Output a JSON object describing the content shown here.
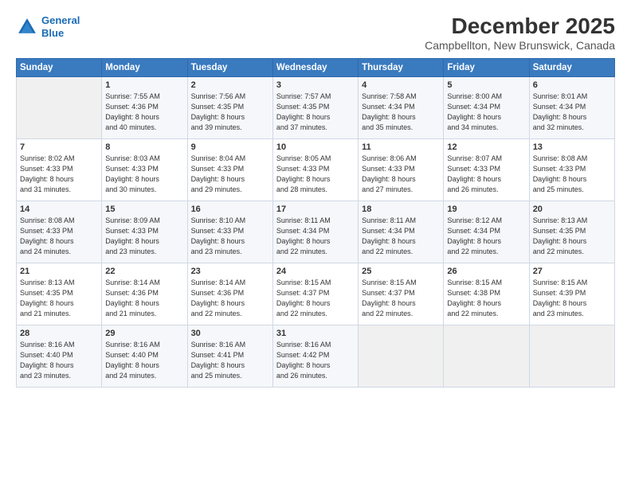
{
  "header": {
    "logo_line1": "General",
    "logo_line2": "Blue",
    "title": "December 2025",
    "subtitle": "Campbellton, New Brunswick, Canada"
  },
  "days_of_week": [
    "Sunday",
    "Monday",
    "Tuesday",
    "Wednesday",
    "Thursday",
    "Friday",
    "Saturday"
  ],
  "weeks": [
    [
      {
        "day": "",
        "info": ""
      },
      {
        "day": "1",
        "info": "Sunrise: 7:55 AM\nSunset: 4:36 PM\nDaylight: 8 hours\nand 40 minutes."
      },
      {
        "day": "2",
        "info": "Sunrise: 7:56 AM\nSunset: 4:35 PM\nDaylight: 8 hours\nand 39 minutes."
      },
      {
        "day": "3",
        "info": "Sunrise: 7:57 AM\nSunset: 4:35 PM\nDaylight: 8 hours\nand 37 minutes."
      },
      {
        "day": "4",
        "info": "Sunrise: 7:58 AM\nSunset: 4:34 PM\nDaylight: 8 hours\nand 35 minutes."
      },
      {
        "day": "5",
        "info": "Sunrise: 8:00 AM\nSunset: 4:34 PM\nDaylight: 8 hours\nand 34 minutes."
      },
      {
        "day": "6",
        "info": "Sunrise: 8:01 AM\nSunset: 4:34 PM\nDaylight: 8 hours\nand 32 minutes."
      }
    ],
    [
      {
        "day": "7",
        "info": "Sunrise: 8:02 AM\nSunset: 4:33 PM\nDaylight: 8 hours\nand 31 minutes."
      },
      {
        "day": "8",
        "info": "Sunrise: 8:03 AM\nSunset: 4:33 PM\nDaylight: 8 hours\nand 30 minutes."
      },
      {
        "day": "9",
        "info": "Sunrise: 8:04 AM\nSunset: 4:33 PM\nDaylight: 8 hours\nand 29 minutes."
      },
      {
        "day": "10",
        "info": "Sunrise: 8:05 AM\nSunset: 4:33 PM\nDaylight: 8 hours\nand 28 minutes."
      },
      {
        "day": "11",
        "info": "Sunrise: 8:06 AM\nSunset: 4:33 PM\nDaylight: 8 hours\nand 27 minutes."
      },
      {
        "day": "12",
        "info": "Sunrise: 8:07 AM\nSunset: 4:33 PM\nDaylight: 8 hours\nand 26 minutes."
      },
      {
        "day": "13",
        "info": "Sunrise: 8:08 AM\nSunset: 4:33 PM\nDaylight: 8 hours\nand 25 minutes."
      }
    ],
    [
      {
        "day": "14",
        "info": "Sunrise: 8:08 AM\nSunset: 4:33 PM\nDaylight: 8 hours\nand 24 minutes."
      },
      {
        "day": "15",
        "info": "Sunrise: 8:09 AM\nSunset: 4:33 PM\nDaylight: 8 hours\nand 23 minutes."
      },
      {
        "day": "16",
        "info": "Sunrise: 8:10 AM\nSunset: 4:33 PM\nDaylight: 8 hours\nand 23 minutes."
      },
      {
        "day": "17",
        "info": "Sunrise: 8:11 AM\nSunset: 4:34 PM\nDaylight: 8 hours\nand 22 minutes."
      },
      {
        "day": "18",
        "info": "Sunrise: 8:11 AM\nSunset: 4:34 PM\nDaylight: 8 hours\nand 22 minutes."
      },
      {
        "day": "19",
        "info": "Sunrise: 8:12 AM\nSunset: 4:34 PM\nDaylight: 8 hours\nand 22 minutes."
      },
      {
        "day": "20",
        "info": "Sunrise: 8:13 AM\nSunset: 4:35 PM\nDaylight: 8 hours\nand 22 minutes."
      }
    ],
    [
      {
        "day": "21",
        "info": "Sunrise: 8:13 AM\nSunset: 4:35 PM\nDaylight: 8 hours\nand 21 minutes."
      },
      {
        "day": "22",
        "info": "Sunrise: 8:14 AM\nSunset: 4:36 PM\nDaylight: 8 hours\nand 21 minutes."
      },
      {
        "day": "23",
        "info": "Sunrise: 8:14 AM\nSunset: 4:36 PM\nDaylight: 8 hours\nand 22 minutes."
      },
      {
        "day": "24",
        "info": "Sunrise: 8:15 AM\nSunset: 4:37 PM\nDaylight: 8 hours\nand 22 minutes."
      },
      {
        "day": "25",
        "info": "Sunrise: 8:15 AM\nSunset: 4:37 PM\nDaylight: 8 hours\nand 22 minutes."
      },
      {
        "day": "26",
        "info": "Sunrise: 8:15 AM\nSunset: 4:38 PM\nDaylight: 8 hours\nand 22 minutes."
      },
      {
        "day": "27",
        "info": "Sunrise: 8:15 AM\nSunset: 4:39 PM\nDaylight: 8 hours\nand 23 minutes."
      }
    ],
    [
      {
        "day": "28",
        "info": "Sunrise: 8:16 AM\nSunset: 4:40 PM\nDaylight: 8 hours\nand 23 minutes."
      },
      {
        "day": "29",
        "info": "Sunrise: 8:16 AM\nSunset: 4:40 PM\nDaylight: 8 hours\nand 24 minutes."
      },
      {
        "day": "30",
        "info": "Sunrise: 8:16 AM\nSunset: 4:41 PM\nDaylight: 8 hours\nand 25 minutes."
      },
      {
        "day": "31",
        "info": "Sunrise: 8:16 AM\nSunset: 4:42 PM\nDaylight: 8 hours\nand 26 minutes."
      },
      {
        "day": "",
        "info": ""
      },
      {
        "day": "",
        "info": ""
      },
      {
        "day": "",
        "info": ""
      }
    ]
  ]
}
